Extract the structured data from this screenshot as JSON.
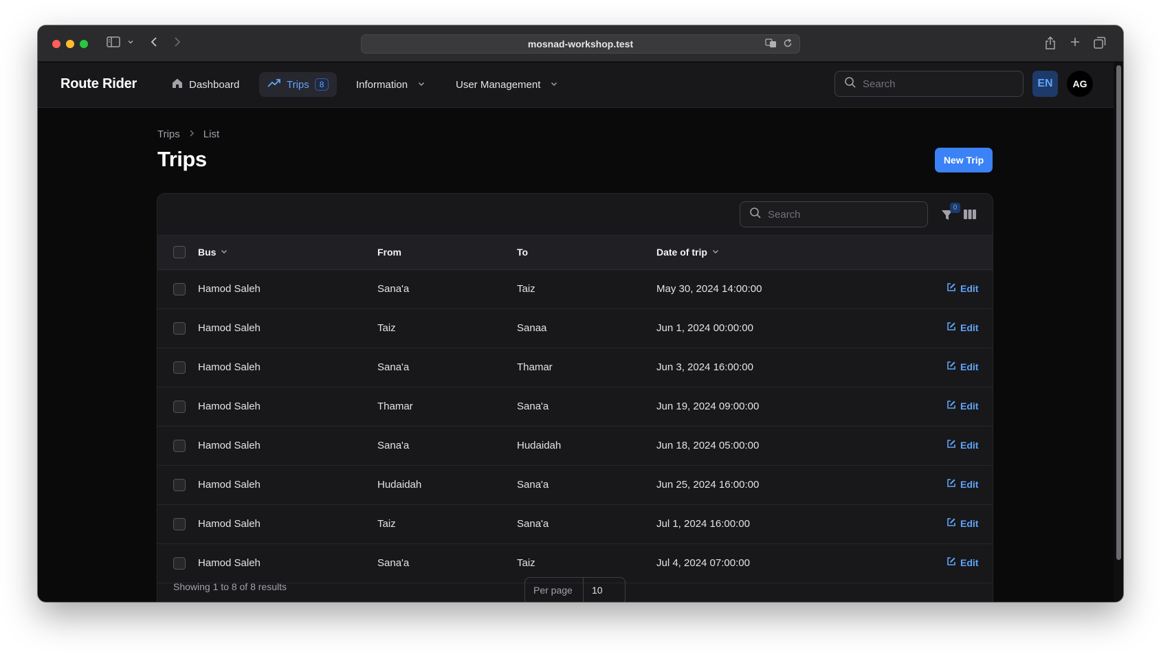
{
  "browser": {
    "url": "mosnad-workshop.test"
  },
  "navbar": {
    "brand": "Route Rider",
    "items": [
      {
        "label": "Dashboard",
        "icon": "home-icon"
      },
      {
        "label": "Trips",
        "icon": "trending-up-icon",
        "badge": "8",
        "active": true
      },
      {
        "label": "Information",
        "icon": "chevron-down-icon"
      },
      {
        "label": "User Management",
        "icon": "chevron-down-icon"
      }
    ],
    "search_placeholder": "Search",
    "language": "EN",
    "avatar_initials": "AG"
  },
  "breadcrumb": [
    "Trips",
    "List"
  ],
  "page": {
    "title": "Trips",
    "new_button": "New Trip"
  },
  "table": {
    "search_placeholder": "Search",
    "filter_count": "0",
    "columns": [
      "Bus",
      "From",
      "To",
      "Date of trip"
    ],
    "edit_label": "Edit",
    "rows": [
      {
        "bus": "Hamod Saleh",
        "from": "Sana'a",
        "to": "Taiz",
        "date": "May 30, 2024 14:00:00"
      },
      {
        "bus": "Hamod Saleh",
        "from": "Taiz",
        "to": "Sanaa",
        "date": "Jun 1, 2024 00:00:00"
      },
      {
        "bus": "Hamod Saleh",
        "from": "Sana'a",
        "to": "Thamar",
        "date": "Jun 3, 2024 16:00:00"
      },
      {
        "bus": "Hamod Saleh",
        "from": "Thamar",
        "to": "Sana'a",
        "date": "Jun 19, 2024 09:00:00"
      },
      {
        "bus": "Hamod Saleh",
        "from": "Sana'a",
        "to": "Hudaidah",
        "date": "Jun 18, 2024 05:00:00"
      },
      {
        "bus": "Hamod Saleh",
        "from": "Hudaidah",
        "to": "Sana'a",
        "date": "Jun 25, 2024 16:00:00"
      },
      {
        "bus": "Hamod Saleh",
        "from": "Taiz",
        "to": "Sana'a",
        "date": "Jul 1, 2024 16:00:00"
      },
      {
        "bus": "Hamod Saleh",
        "from": "Sana'a",
        "to": "Taiz",
        "date": "Jul 4, 2024 07:00:00"
      }
    ],
    "footer_text": "Showing 1 to 8 of 8 results",
    "per_page_label": "Per page",
    "per_page_value": "10"
  },
  "colors": {
    "accent": "#3b82f6",
    "background": "#0a0a0b",
    "surface": "#18181b"
  }
}
